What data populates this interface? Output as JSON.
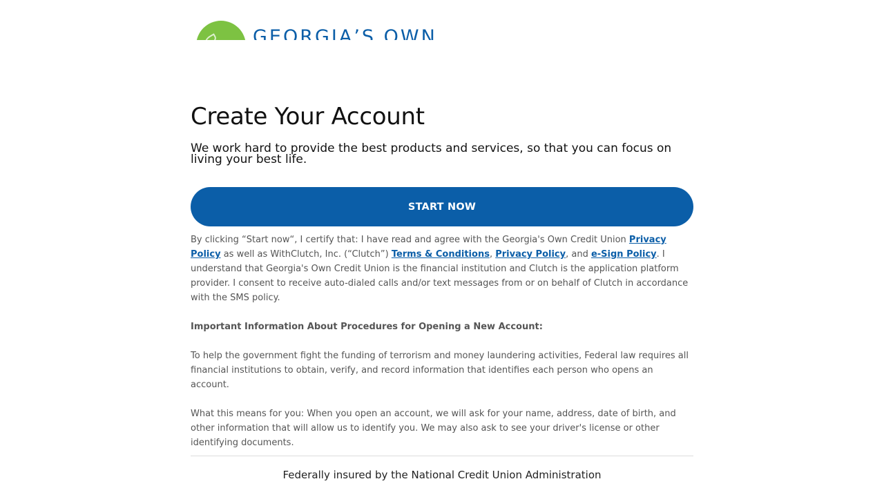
{
  "brand": {
    "logo_text": "GEORGIA’S OWN",
    "logo_icon": "leaf-icon",
    "primary_color": "#0b5ea8",
    "logo_green": "#7dc242"
  },
  "header": {
    "title": "Create Your Account",
    "subtitle": "We work hard to provide the best products and services, so that you can focus on living your best life."
  },
  "cta": {
    "start_label": "START NOW"
  },
  "consent": {
    "part1": "By clicking “Start now“, I certify that: I have read and agree with the Georgia's Own Credit Union ",
    "link_privacy_1": "Privacy Policy",
    "part2": " as well as WithClutch, Inc. (“Clutch”) ",
    "link_terms": "Terms & Conditions",
    "sep1": ", ",
    "link_privacy_2": "Privacy Policy",
    "sep2": ", and ",
    "link_esign": "e-Sign Policy",
    "part3": ". I understand that Georgia's Own Credit Union is the financial institution and Clutch is the application platform provider. I consent to receive auto-dialed calls and/or text messages from or on behalf of Clutch in accordance with the SMS policy."
  },
  "procedures": {
    "heading": "Important Information About Procedures for Opening a New Account:",
    "paragraph1": "To help the government fight the funding of terrorism and money laundering activities, Federal law requires all financial institutions to obtain, verify, and record information that identifies each person who opens an account.",
    "paragraph2": "What this means for you: When you open an account, we will ask for your name, address, date of birth, and other information that will allow us to identify you. We may also ask to see your driver's license or other identifying documents."
  },
  "footer": {
    "text": "Federally insured by the National Credit Union Administration"
  }
}
